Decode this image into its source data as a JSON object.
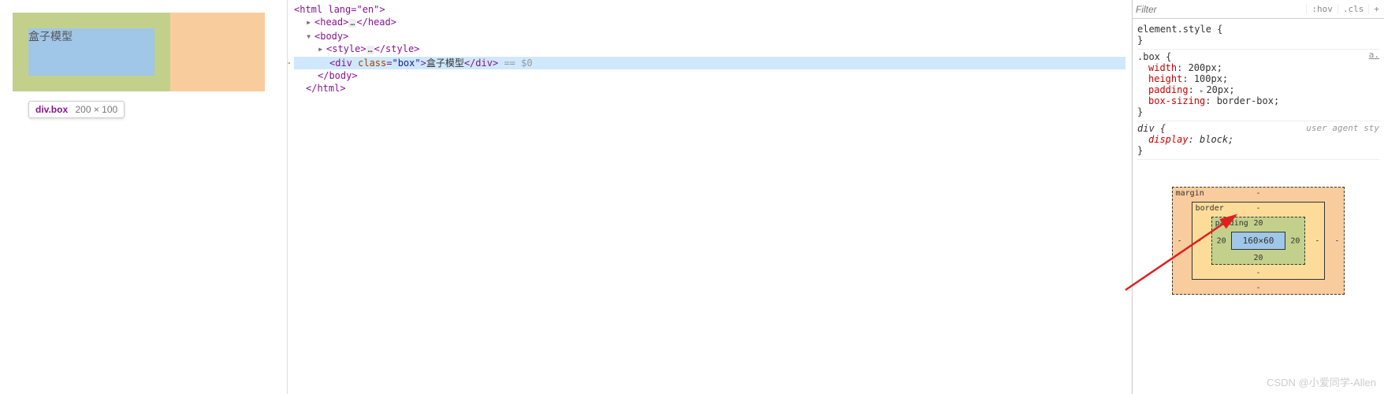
{
  "preview": {
    "box_text": "盒子模型",
    "tooltip_selector": "div.box",
    "tooltip_dims": "200 × 100"
  },
  "dom": {
    "html_open": "<html lang=\"en\">",
    "head": "<head>…</head>",
    "body_open": "<body>",
    "style": "<style>…</style>",
    "selected_open_tag": "<div ",
    "selected_attr_name": "class",
    "selected_attr_val": "\"box\"",
    "selected_close_open": ">",
    "selected_text": "盒子模型",
    "selected_close": "</div>",
    "eq0": " == $0",
    "body_close": "</body>",
    "html_close": "</html>"
  },
  "styles": {
    "filter_placeholder": "Filter",
    "hov": ":hov",
    "cls": ".cls",
    "plus": "+",
    "element_style": "element.style {",
    "element_style_close": "}",
    "box_selector": ".box {",
    "box_link": "a.",
    "width": {
      "name": "width",
      "val": "200px;"
    },
    "height": {
      "name": "height",
      "val": "100px;"
    },
    "padding": {
      "name": "padding",
      "val": "20px;"
    },
    "box_sizing": {
      "name": "box-sizing",
      "val": "border-box;"
    },
    "box_close": "}",
    "div_selector": "div {",
    "ua_label": "user agent sty",
    "display": {
      "name": "display",
      "val": "block;"
    },
    "div_close": "}"
  },
  "box_model": {
    "margin_label": "margin",
    "border_label": "border",
    "padding_label": "padding",
    "padding_top": "20",
    "padding_right": "20",
    "padding_bottom": "20",
    "padding_left": "20",
    "content": "160×60",
    "dash": "-"
  },
  "watermark": "CSDN @小爱同学-Allen"
}
